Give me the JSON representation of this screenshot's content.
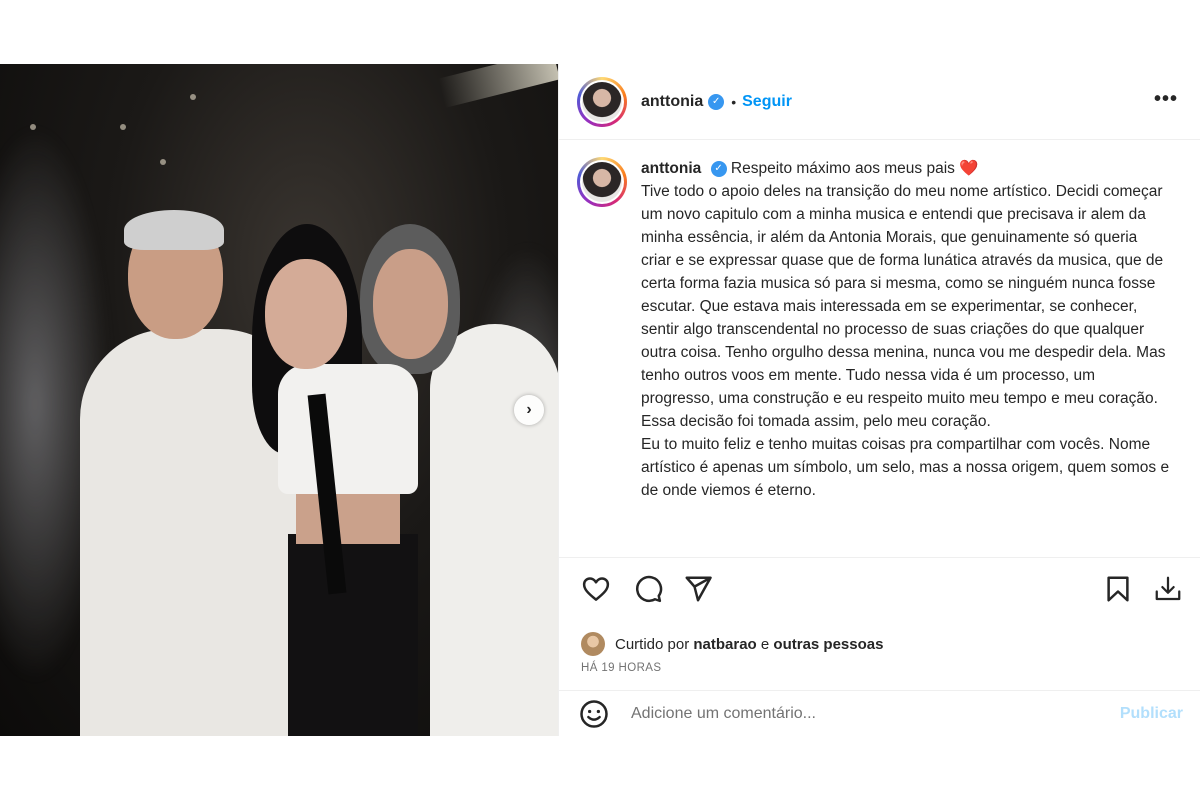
{
  "post": {
    "author": {
      "username": "anttonia",
      "verified_icon": "verified-badge-icon",
      "follow_label": "Seguir",
      "separator": "•",
      "more_icon": "more-options-icon",
      "more_glyph": "•••"
    },
    "photo": {
      "next_icon": "chevron-right-icon",
      "next_glyph": "›"
    },
    "caption": {
      "username": "anttonia",
      "first_line": "Respeito máximo aos meus pais",
      "heart": "❤️",
      "body": "Tive todo o apoio deles na transição do meu nome artístico. Decidi começar um novo capitulo com a minha musica e entendi que precisava ir alem da minha essência, ir além da Antonia Morais, que genuinamente só queria criar e se expressar quase que de forma lunática através da musica, que de certa forma fazia musica só para si mesma, como se ninguém nunca fosse escutar. Que estava mais interessada em se experimentar, se conhecer, sentir algo transcendental no processo de suas criações do que qualquer outra coisa. Tenho orgulho dessa menina, nunca vou me despedir dela. Mas tenho outros voos em mente. Tudo nessa vida é um processo, um progresso, uma construção e eu respeito muito meu tempo e meu coração. Essa decisão foi tomada assim, pelo meu coração.",
      "body2": "Eu to muito feliz e tenho muitas coisas pra compartilhar com vocês. Nome artístico é apenas um símbolo, um selo, mas a nossa origem, quem somos e de onde viemos é eterno."
    },
    "actions": {
      "like_icon": "heart-icon",
      "comment_icon": "comment-icon",
      "share_icon": "send-icon",
      "save_icon": "bookmark-icon",
      "download_icon": "download-icon"
    },
    "likes": {
      "prefix": "Curtido por",
      "liker": "natbarao",
      "connector": "e",
      "others": "outras pessoas"
    },
    "timestamp": "HÁ 19 HORAS",
    "comment": {
      "emoji_icon": "emoji-icon",
      "placeholder": "Adicione um comentário...",
      "publish_label": "Publicar"
    },
    "colors": {
      "accent": "#0095f6",
      "verified": "#3797f0",
      "publish_disabled": "#b2dffc",
      "text": "#262626",
      "muted": "#737373"
    }
  }
}
